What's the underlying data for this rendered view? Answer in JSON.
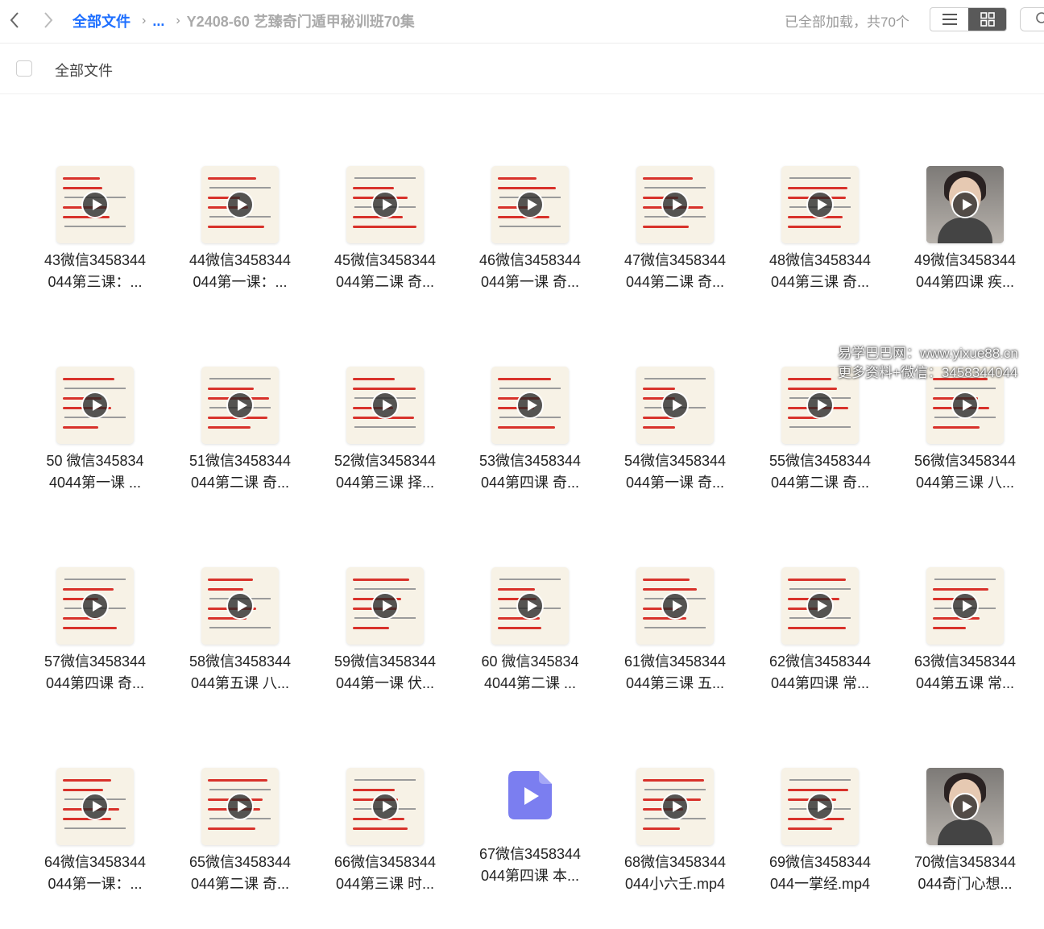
{
  "topbar": {
    "back_icon": "chevron-left-icon",
    "forward_icon": "chevron-right-icon",
    "breadcrumb_root": "全部文件",
    "breadcrumb_ellipsis": "...",
    "breadcrumb_current": "Y2408-60 艺臻奇门遁甲秘训班70集",
    "status": "已全部加载，共70个",
    "list_view_icon": "list-view-icon",
    "grid_view_icon": "grid-view-icon"
  },
  "subbar": {
    "label": "全部文件"
  },
  "files": [
    {
      "line1": "43微信3458344",
      "line2": "044第三课：..."
    },
    {
      "line1": "44微信3458344",
      "line2": "044第一课：..."
    },
    {
      "line1": "45微信3458344",
      "line2": "044第二课 奇..."
    },
    {
      "line1": "46微信3458344",
      "line2": "044第一课 奇..."
    },
    {
      "line1": "47微信3458344",
      "line2": "044第二课 奇..."
    },
    {
      "line1": "48微信3458344",
      "line2": "044第三课 奇..."
    },
    {
      "line1": "49微信3458344",
      "line2": "044第四课 疾..."
    },
    {
      "line1": "50 微信345834",
      "line2": "4044第一课 ..."
    },
    {
      "line1": "51微信3458344",
      "line2": "044第二课 奇..."
    },
    {
      "line1": "52微信3458344",
      "line2": "044第三课 择..."
    },
    {
      "line1": "53微信3458344",
      "line2": "044第四课 奇..."
    },
    {
      "line1": "54微信3458344",
      "line2": "044第一课 奇..."
    },
    {
      "line1": "55微信3458344",
      "line2": "044第二课 奇..."
    },
    {
      "line1": "56微信3458344",
      "line2": "044第三课 八..."
    },
    {
      "line1": "57微信3458344",
      "line2": "044第四课 奇..."
    },
    {
      "line1": "58微信3458344",
      "line2": "044第五课 八..."
    },
    {
      "line1": "59微信3458344",
      "line2": "044第一课 伏..."
    },
    {
      "line1": "60 微信345834",
      "line2": "4044第二课 ..."
    },
    {
      "line1": "61微信3458344",
      "line2": "044第三课 五..."
    },
    {
      "line1": "62微信3458344",
      "line2": "044第四课 常..."
    },
    {
      "line1": "63微信3458344",
      "line2": "044第五课 常..."
    },
    {
      "line1": "64微信3458344",
      "line2": "044第一课：..."
    },
    {
      "line1": "65微信3458344",
      "line2": "044第二课 奇..."
    },
    {
      "line1": "66微信3458344",
      "line2": "044第三课 时..."
    },
    {
      "line1": "67微信3458344",
      "line2": "044第四课 本..."
    },
    {
      "line1": "68微信3458344",
      "line2": "044小六壬.mp4"
    },
    {
      "line1": "69微信3458344",
      "line2": "044一掌经.mp4"
    },
    {
      "line1": "70微信3458344",
      "line2": "044奇门心想..."
    }
  ],
  "thumbnail_kinds": [
    "slide",
    "slide",
    "slide",
    "slide",
    "slide",
    "slide",
    "person",
    "slide",
    "slide",
    "slide",
    "slide",
    "slide",
    "slide",
    "slide",
    "slide",
    "slide",
    "slide",
    "slide",
    "slide",
    "slide",
    "slide",
    "slide",
    "slide",
    "slide",
    "video-file-icon",
    "slide",
    "slide",
    "person"
  ],
  "watermark": {
    "line1": "易学巴巴网：www.yixue88.cn",
    "line2": "更多资料+微信：3458344044"
  },
  "colors": {
    "accent": "#1e6fff",
    "slide_red": "#d8322b",
    "file_icon": "#7b7ef0"
  }
}
